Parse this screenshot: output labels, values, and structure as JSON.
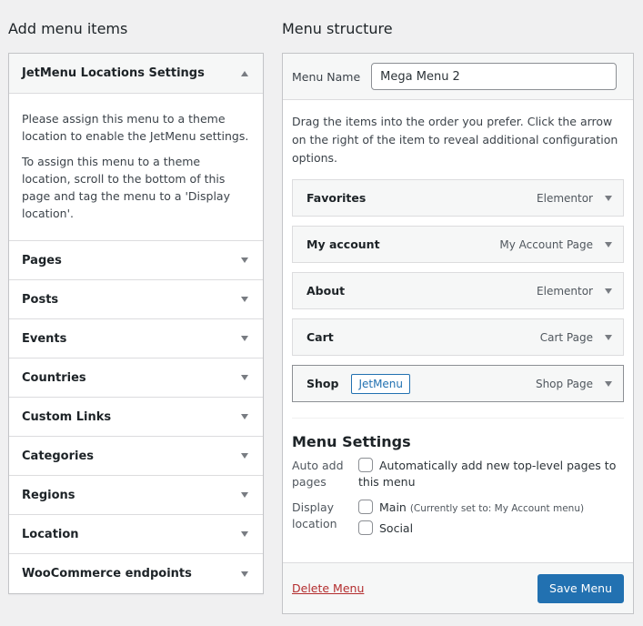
{
  "left": {
    "title": "Add menu items",
    "open_section": {
      "label": "JetMenu Locations Settings",
      "paragraphs": [
        "Please assign this menu to a theme location to enable the JetMenu settings.",
        "To assign this menu to a theme location, scroll to the bottom of this page and tag the menu to a 'Display location'."
      ]
    },
    "sections": [
      {
        "label": "Pages"
      },
      {
        "label": "Posts"
      },
      {
        "label": "Events"
      },
      {
        "label": "Countries"
      },
      {
        "label": "Custom Links"
      },
      {
        "label": "Categories"
      },
      {
        "label": "Regions"
      },
      {
        "label": "Location"
      },
      {
        "label": "WooCommerce endpoints"
      }
    ]
  },
  "right": {
    "title": "Menu structure",
    "menu_name_label": "Menu Name",
    "menu_name_value": "Mega Menu 2",
    "help_text": "Drag the items into the order you prefer. Click the arrow on the right of the item to reveal additional configuration options.",
    "items": [
      {
        "title": "Favorites",
        "type": "Elementor"
      },
      {
        "title": "My account",
        "type": "My Account Page"
      },
      {
        "title": "About",
        "type": "Elementor"
      },
      {
        "title": "Cart",
        "type": "Cart Page"
      },
      {
        "title": "Shop",
        "type": "Shop Page",
        "badge": "JetMenu"
      }
    ],
    "settings": {
      "title": "Menu Settings",
      "auto_add_label": "Auto add pages",
      "auto_add_option": "Automatically add new top-level pages to this menu",
      "display_label": "Display location",
      "locations": [
        {
          "label": "Main",
          "note": "(Currently set to: My Account menu)"
        },
        {
          "label": "Social",
          "note": ""
        }
      ]
    },
    "delete_label": "Delete Menu",
    "save_label": "Save Menu"
  }
}
